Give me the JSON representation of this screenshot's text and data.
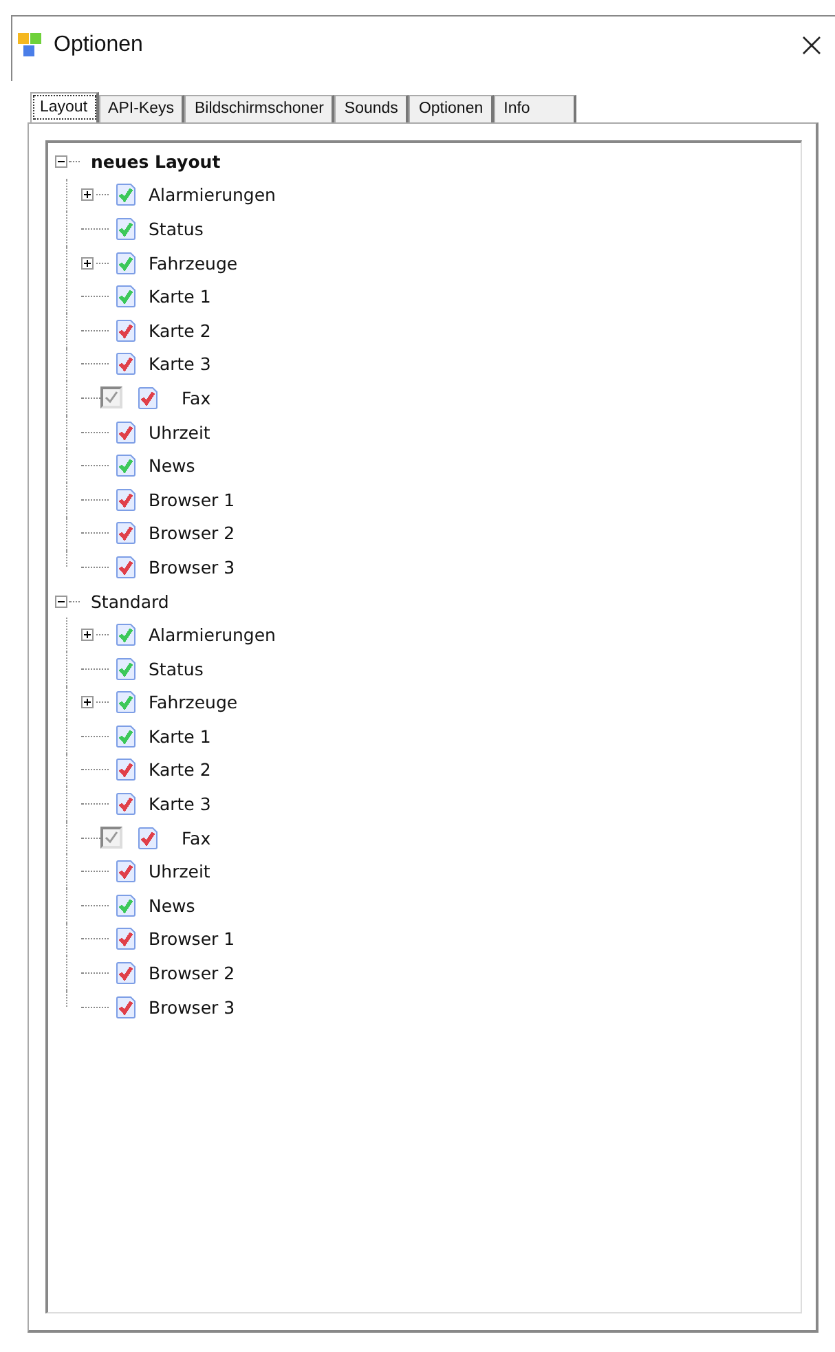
{
  "window": {
    "title": "Optionen"
  },
  "tabs": [
    {
      "label": "Layout",
      "selected": true
    },
    {
      "label": "API-Keys",
      "selected": false
    },
    {
      "label": "Bildschirmschoner",
      "selected": false
    },
    {
      "label": "Sounds",
      "selected": false
    },
    {
      "label": "Optionen",
      "selected": false
    },
    {
      "label": "Info",
      "selected": false
    }
  ],
  "tree": [
    {
      "label": "neues Layout",
      "active": true,
      "expanded": true,
      "children": [
        {
          "label": "Alarmierungen",
          "kind": "item",
          "has_children": true,
          "color": "#3cc85a"
        },
        {
          "label": "Status",
          "kind": "item",
          "has_children": false,
          "color": "#3cc85a"
        },
        {
          "label": "Fahrzeuge",
          "kind": "item",
          "has_children": true,
          "color": "#3cc85a"
        },
        {
          "label": "Karte 1",
          "kind": "item",
          "has_children": false,
          "color": "#3cc85a"
        },
        {
          "label": "Karte 2",
          "kind": "item",
          "has_children": false,
          "color": "#e0404a"
        },
        {
          "label": "Karte 3",
          "kind": "item",
          "has_children": false,
          "color": "#e0404a"
        },
        {
          "label": "Fax",
          "kind": "checkbox",
          "checked": true,
          "has_children": false,
          "color": "#e0404a"
        },
        {
          "label": "Uhrzeit",
          "kind": "item",
          "has_children": false,
          "color": "#e0404a"
        },
        {
          "label": "News",
          "kind": "item",
          "has_children": false,
          "color": "#3cc85a"
        },
        {
          "label": "Browser 1",
          "kind": "item",
          "has_children": false,
          "color": "#e0404a"
        },
        {
          "label": "Browser 2",
          "kind": "item",
          "has_children": false,
          "color": "#e0404a"
        },
        {
          "label": "Browser 3",
          "kind": "item",
          "has_children": false,
          "color": "#e0404a"
        }
      ]
    },
    {
      "label": "Standard",
      "active": false,
      "expanded": true,
      "children": [
        {
          "label": "Alarmierungen",
          "kind": "item",
          "has_children": true,
          "color": "#3cc85a"
        },
        {
          "label": "Status",
          "kind": "item",
          "has_children": false,
          "color": "#3cc85a"
        },
        {
          "label": "Fahrzeuge",
          "kind": "item",
          "has_children": true,
          "color": "#3cc85a"
        },
        {
          "label": "Karte 1",
          "kind": "item",
          "has_children": false,
          "color": "#3cc85a"
        },
        {
          "label": "Karte 2",
          "kind": "item",
          "has_children": false,
          "color": "#e0404a"
        },
        {
          "label": "Karte 3",
          "kind": "item",
          "has_children": false,
          "color": "#e0404a"
        },
        {
          "label": "Fax",
          "kind": "checkbox",
          "checked": true,
          "has_children": false,
          "color": "#e0404a"
        },
        {
          "label": "Uhrzeit",
          "kind": "item",
          "has_children": false,
          "color": "#e0404a"
        },
        {
          "label": "News",
          "kind": "item",
          "has_children": false,
          "color": "#3cc85a"
        },
        {
          "label": "Browser 1",
          "kind": "item",
          "has_children": false,
          "color": "#e0404a"
        },
        {
          "label": "Browser 2",
          "kind": "item",
          "has_children": false,
          "color": "#e0404a"
        },
        {
          "label": "Browser 3",
          "kind": "item",
          "has_children": false,
          "color": "#e0404a"
        }
      ]
    }
  ]
}
